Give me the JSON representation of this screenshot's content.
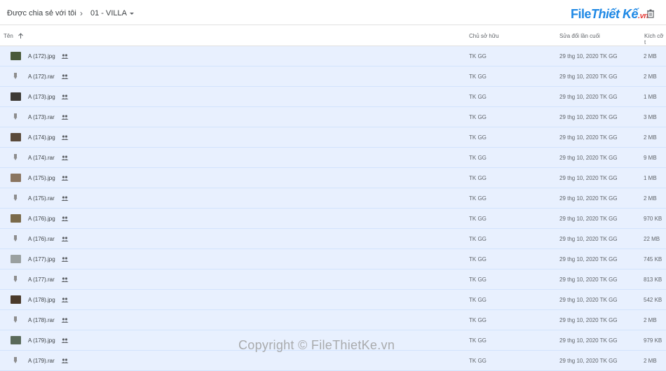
{
  "breadcrumb": {
    "root": "Được chia sẻ với tôi",
    "separator": "›",
    "current": "01 - VILLA"
  },
  "logo": {
    "file": "File",
    "rest": "Thiết Kế",
    "tld": ".vn"
  },
  "columns": {
    "name": "Tên",
    "owner": "Chủ sở hữu",
    "modified": "Sửa đổi lần cuối",
    "size": "Kích cỡ t"
  },
  "files": [
    {
      "name": "A (172).jpg",
      "type": "image",
      "owner": "TK GG",
      "modified": "29 thg 10, 2020 TK GG",
      "size": "2 MB",
      "thumb": "#4a5a3a"
    },
    {
      "name": "A (172).rar",
      "type": "archive",
      "owner": "TK GG",
      "modified": "29 thg 10, 2020 TK GG",
      "size": "2 MB"
    },
    {
      "name": "A (173).jpg",
      "type": "image",
      "owner": "TK GG",
      "modified": "29 thg 10, 2020 TK GG",
      "size": "1 MB",
      "thumb": "#3d3a35"
    },
    {
      "name": "A (173).rar",
      "type": "archive",
      "owner": "TK GG",
      "modified": "29 thg 10, 2020 TK GG",
      "size": "3 MB"
    },
    {
      "name": "A (174).jpg",
      "type": "image",
      "owner": "TK GG",
      "modified": "29 thg 10, 2020 TK GG",
      "size": "2 MB",
      "thumb": "#5a4a3a"
    },
    {
      "name": "A (174).rar",
      "type": "archive",
      "owner": "TK GG",
      "modified": "29 thg 10, 2020 TK GG",
      "size": "9 MB"
    },
    {
      "name": "A (175).jpg",
      "type": "image",
      "owner": "TK GG",
      "modified": "29 thg 10, 2020 TK GG",
      "size": "1 MB",
      "thumb": "#8a7560"
    },
    {
      "name": "A (175).rar",
      "type": "archive",
      "owner": "TK GG",
      "modified": "29 thg 10, 2020 TK GG",
      "size": "2 MB"
    },
    {
      "name": "A (176).jpg",
      "type": "image",
      "owner": "TK GG",
      "modified": "29 thg 10, 2020 TK GG",
      "size": "970 KB",
      "thumb": "#7a6a4a"
    },
    {
      "name": "A (176).rar",
      "type": "archive",
      "owner": "TK GG",
      "modified": "29 thg 10, 2020 TK GG",
      "size": "22 MB"
    },
    {
      "name": "A (177).jpg",
      "type": "image",
      "owner": "TK GG",
      "modified": "29 thg 10, 2020 TK GG",
      "size": "745 KB",
      "thumb": "#9aa0a0"
    },
    {
      "name": "A (177).rar",
      "type": "archive",
      "owner": "TK GG",
      "modified": "29 thg 10, 2020 TK GG",
      "size": "813 KB"
    },
    {
      "name": "A (178).jpg",
      "type": "image",
      "owner": "TK GG",
      "modified": "29 thg 10, 2020 TK GG",
      "size": "542 KB",
      "thumb": "#4a3a2a"
    },
    {
      "name": "A (178).rar",
      "type": "archive",
      "owner": "TK GG",
      "modified": "29 thg 10, 2020 TK GG",
      "size": "2 MB"
    },
    {
      "name": "A (179).jpg",
      "type": "image",
      "owner": "TK GG",
      "modified": "29 thg 10, 2020 TK GG",
      "size": "979 KB",
      "thumb": "#5a6a5a"
    },
    {
      "name": "A (179).rar",
      "type": "archive",
      "owner": "TK GG",
      "modified": "29 thg 10, 2020 TK GG",
      "size": "2 MB"
    }
  ],
  "watermark": "Copyright © FileThietKe.vn"
}
